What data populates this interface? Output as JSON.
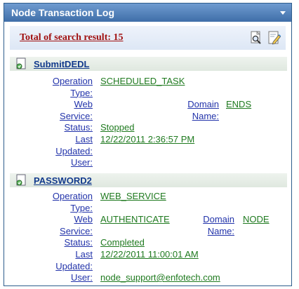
{
  "panel": {
    "title": "Node Transaction Log"
  },
  "summary": {
    "total_label": "Total of search result: 15"
  },
  "toolbar": {
    "search_icon": "magnifier-page-icon",
    "edit_icon": "pencil-page-icon"
  },
  "records": [
    {
      "name": "SubmitDEDL",
      "operation_type_label": "Operation\nType:",
      "operation_type": "SCHEDULED_TASK",
      "web_service_label": "Web\nService:",
      "web_service": "",
      "domain_name_label": "Domain\nName:",
      "domain_name": "ENDS",
      "status_label": "Status:",
      "status": "Stopped",
      "last_updated_label": "Last\nUpdated:",
      "last_updated": "12/22/2011 2:36:57 PM",
      "user_label": "User:",
      "user": ""
    },
    {
      "name": "PASSWORD2",
      "operation_type_label": "Operation\nType:",
      "operation_type": "WEB_SERVICE",
      "web_service_label": "Web\nService:",
      "web_service": "AUTHENTICATE",
      "domain_name_label": "Domain\nName:",
      "domain_name": "NODE",
      "status_label": "Status:",
      "status": "Completed",
      "last_updated_label": "Last\nUpdated:",
      "last_updated": "12/22/2011 11:00:01 AM",
      "user_label": "User:",
      "user": "node_support@enfotech.com"
    }
  ]
}
